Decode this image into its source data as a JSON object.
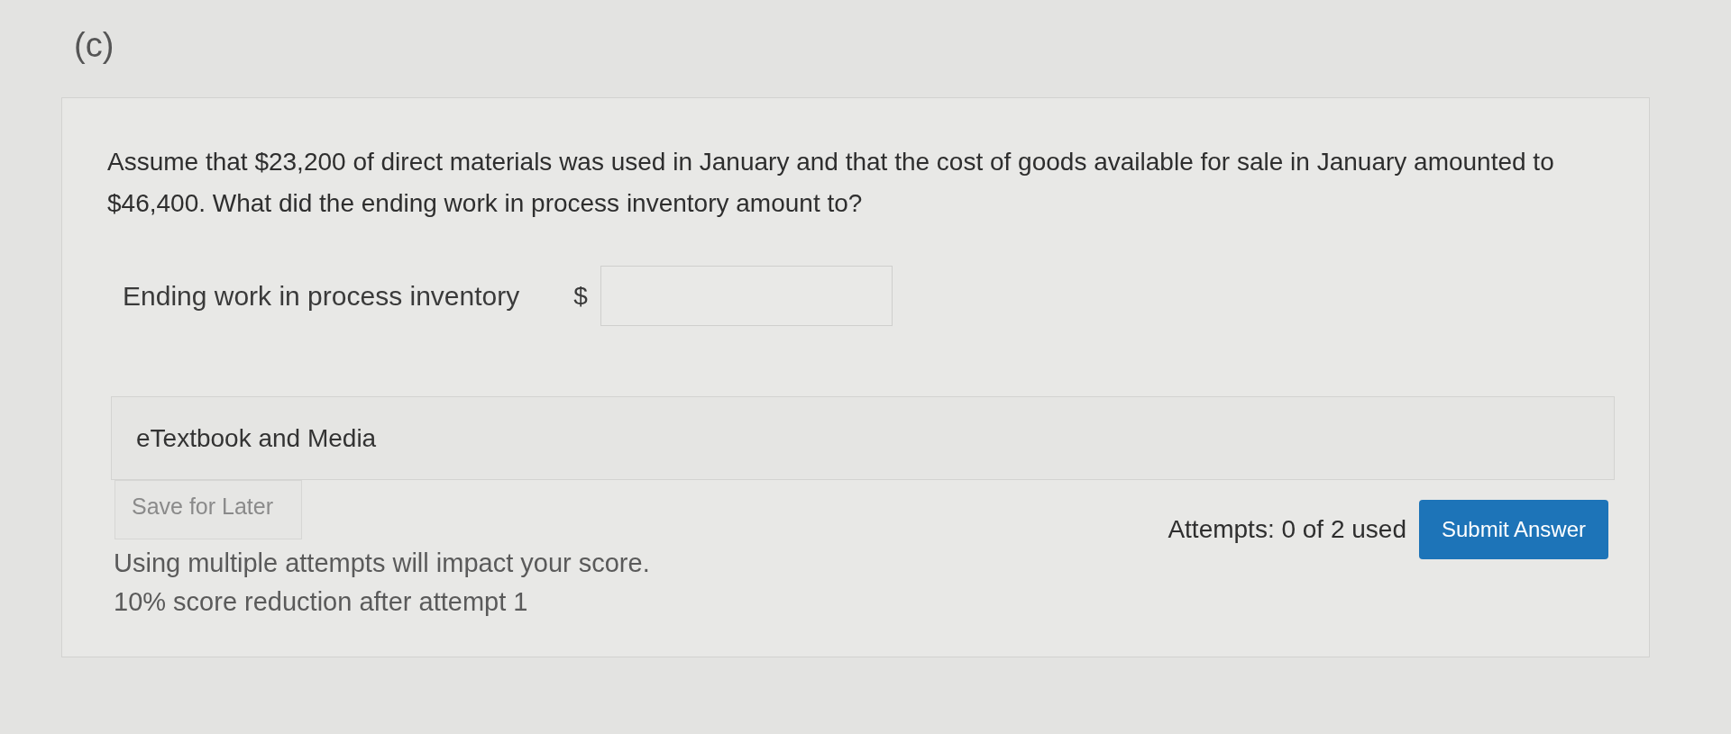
{
  "part_label": "(c)",
  "question": {
    "text": "Assume that $23,200 of direct materials was used in January and that the cost of goods available for sale in January amounted to $46,400. What did the ending work in process inventory amount to?"
  },
  "answer_row": {
    "label": "Ending work in process inventory",
    "currency": "$"
  },
  "resources": {
    "label": "eTextbook and Media"
  },
  "save_button": {
    "label": "Save for Later",
    "disabled": true
  },
  "notes": [
    "Using multiple attempts will impact your score.",
    "10% score reduction after attempt 1"
  ],
  "attempts": "Attempts: 0 of 2 used",
  "submit_button": {
    "label": "Submit Answer"
  }
}
